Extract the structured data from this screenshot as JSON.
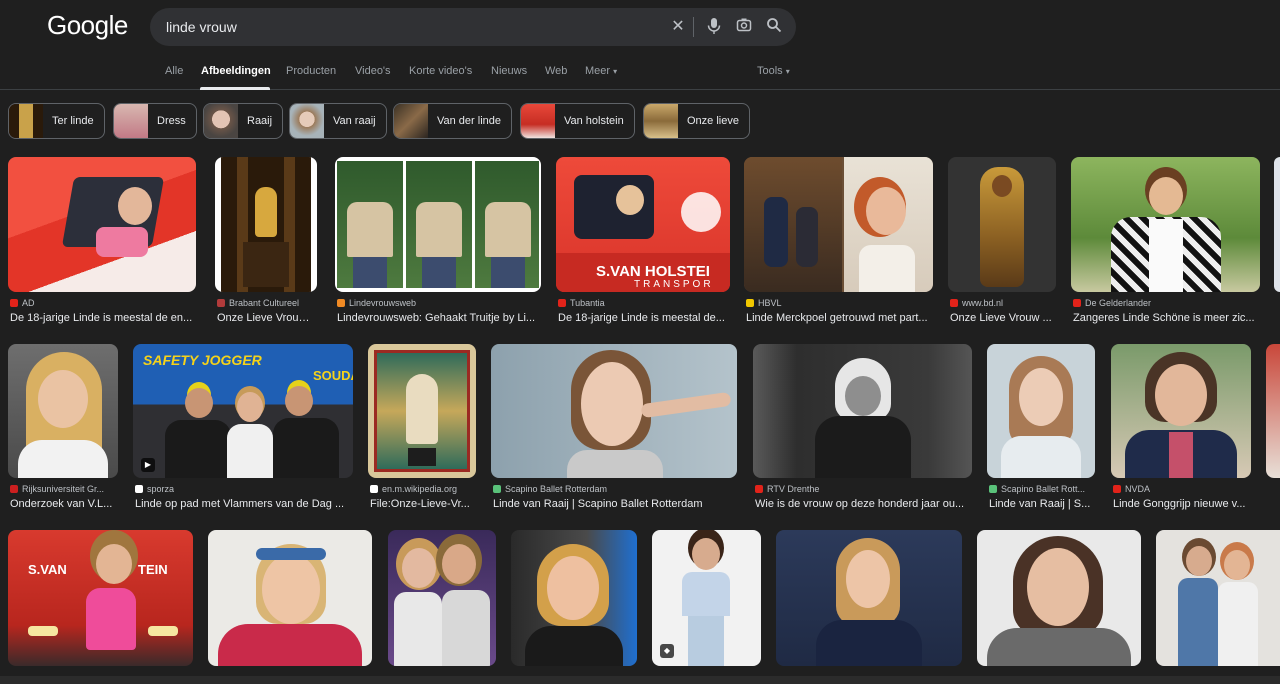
{
  "search": {
    "logo": "Google",
    "query": "linde vrouw"
  },
  "tabs": [
    {
      "label": "Alle"
    },
    {
      "label": "Afbeeldingen"
    },
    {
      "label": "Producten"
    },
    {
      "label": "Video's"
    },
    {
      "label": "Korte video's"
    },
    {
      "label": "Nieuws"
    },
    {
      "label": "Web"
    },
    {
      "label": "Meer"
    }
  ],
  "tools": {
    "label": "Tools"
  },
  "chips": [
    {
      "label": "Ter linde"
    },
    {
      "label": "Dress"
    },
    {
      "label": "Raaij"
    },
    {
      "label": "Van raaij"
    },
    {
      "label": "Van der linde"
    },
    {
      "label": "Van holstein"
    },
    {
      "label": "Onze lieve"
    }
  ],
  "results": [
    {
      "source": "AD",
      "title": "De 18-jarige Linde is meestal de en..."
    },
    {
      "source": "Brabant Cultureel",
      "title": "Onze Lieve Vrouw ..."
    },
    {
      "source": "Lindevrouwsweb",
      "title": "Lindevrouwsweb: Gehaakt Truitje by Li..."
    },
    {
      "source": "Tubantia",
      "title": "De 18-jarige Linde is meestal de..."
    },
    {
      "source": "HBVL",
      "title": "Linde Merckpoel getrouwd met part..."
    },
    {
      "source": "www.bd.nl",
      "title": "Onze Lieve Vrouw ..."
    },
    {
      "source": "De Gelderlander",
      "title": "Zangeres Linde Schöne is meer zic..."
    },
    {
      "source": "Rijksuniversiteit Gr...",
      "title": "Onderzoek van V.L..."
    },
    {
      "source": "sporza",
      "title": "Linde op pad met Vlammers van de Dag ..."
    },
    {
      "source": "en.m.wikipedia.org",
      "title": "File:Onze-Lieve-Vr..."
    },
    {
      "source": "Scapino Ballet Rotterdam",
      "title": "Linde van Raaij | Scapino Ballet Rotterdam"
    },
    {
      "source": "RTV Drenthe",
      "title": "Wie is de vrouw op deze honderd jaar ou..."
    },
    {
      "source": "Scapino Ballet Rott...",
      "title": "Linde van Raaij | S..."
    },
    {
      "source": "NVDA",
      "title": "Linde Gonggrijp nieuwe v..."
    }
  ],
  "thumb_text": {
    "truck1": "S.VAN HOLSTEI",
    "truck1b": "TRANSPOR",
    "banner": "SAFETY JOGGER",
    "banner2": "SOUDA",
    "truck2": "S.VAN",
    "truck2b": "TEIN"
  }
}
